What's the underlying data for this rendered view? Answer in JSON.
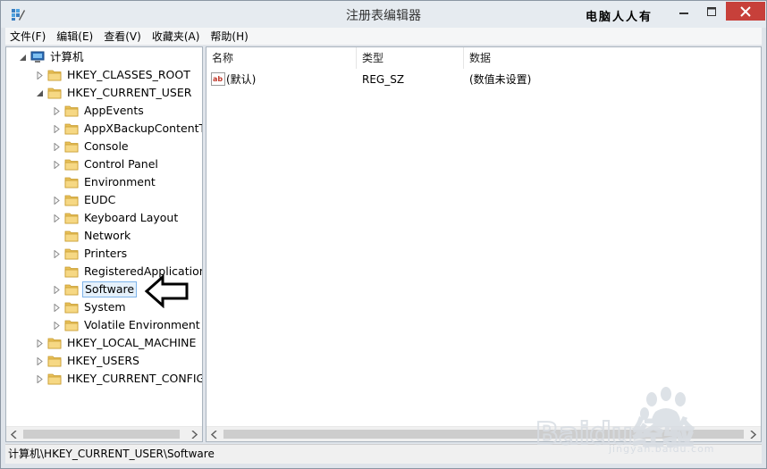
{
  "window": {
    "title": "注册表编辑器",
    "brand": "电脑人人有"
  },
  "menu": [
    "文件(F)",
    "编辑(E)",
    "查看(V)",
    "收藏夹(A)",
    "帮助(H)"
  ],
  "tree": {
    "root": "计算机",
    "items": [
      {
        "label": "HKEY_CLASSES_ROOT",
        "level": 1,
        "expander": "collapsed"
      },
      {
        "label": "HKEY_CURRENT_USER",
        "level": 1,
        "expander": "expanded"
      },
      {
        "label": "AppEvents",
        "level": 2,
        "expander": "collapsed"
      },
      {
        "label": "AppXBackupContentTy",
        "level": 2,
        "expander": "collapsed"
      },
      {
        "label": "Console",
        "level": 2,
        "expander": "collapsed"
      },
      {
        "label": "Control Panel",
        "level": 2,
        "expander": "collapsed"
      },
      {
        "label": "Environment",
        "level": 2,
        "expander": "none"
      },
      {
        "label": "EUDC",
        "level": 2,
        "expander": "collapsed"
      },
      {
        "label": "Keyboard Layout",
        "level": 2,
        "expander": "collapsed"
      },
      {
        "label": "Network",
        "level": 2,
        "expander": "none"
      },
      {
        "label": "Printers",
        "level": 2,
        "expander": "collapsed"
      },
      {
        "label": "RegisteredApplications",
        "level": 2,
        "expander": "none"
      },
      {
        "label": "Software",
        "level": 2,
        "expander": "collapsed",
        "selected": true
      },
      {
        "label": "System",
        "level": 2,
        "expander": "collapsed"
      },
      {
        "label": "Volatile Environment",
        "level": 2,
        "expander": "collapsed"
      },
      {
        "label": "HKEY_LOCAL_MACHINE",
        "level": 1,
        "expander": "collapsed"
      },
      {
        "label": "HKEY_USERS",
        "level": 1,
        "expander": "collapsed"
      },
      {
        "label": "HKEY_CURRENT_CONFIG",
        "level": 1,
        "expander": "collapsed"
      }
    ]
  },
  "list": {
    "columns": [
      "名称",
      "类型",
      "数据"
    ],
    "rows": [
      {
        "name": "(默认)",
        "type": "REG_SZ",
        "data": "(数值未设置)"
      }
    ]
  },
  "status": "计算机\\HKEY_CURRENT_USER\\Software",
  "watermark": {
    "logo": "Baidu经验",
    "url": "jingyan.baidu.com"
  },
  "colors": {
    "selection_bg": "#e5f1fb",
    "selection_border": "#7eb4ea",
    "close_button": "#c7403a",
    "folder": "#e8c15a"
  }
}
